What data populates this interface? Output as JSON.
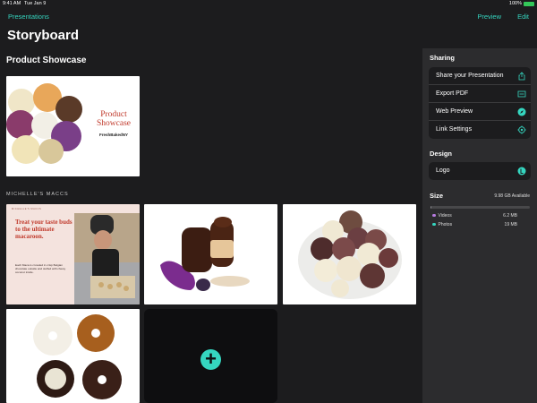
{
  "status": {
    "time": "9:41 AM",
    "date": "Tue Jan 9",
    "battery": "100%"
  },
  "nav": {
    "back": "Presentations",
    "preview": "Preview",
    "edit": "Edit"
  },
  "page": {
    "title": "Storyboard",
    "section": "Product Showcase",
    "subsection": "MICHELLE'S MACCS"
  },
  "tiles": {
    "showcase": {
      "title": "Product Showcase",
      "subtitle": "FreshBakedNY"
    },
    "flyer": {
      "header": "MICHELLE'S MACCS",
      "headline": "Treat your taste buds to the ultimate macaroon.",
      "body": "Each Maca is crowded in crisp Belgian chocolate outside and stuffed with chewy coconut inside."
    },
    "add_icon": "plus-icon"
  },
  "sidebar": {
    "sharing_heading": "Sharing",
    "sharing": [
      {
        "label": "Share your Presentation",
        "icon": "share-icon"
      },
      {
        "label": "Export PDF",
        "icon": "pdf-icon"
      },
      {
        "label": "Web Preview",
        "icon": "compass-icon"
      },
      {
        "label": "Link Settings",
        "icon": "gear-icon"
      }
    ],
    "design_heading": "Design",
    "design": [
      {
        "label": "Logo",
        "icon": "logo-icon"
      }
    ],
    "size_heading": "Size",
    "available": "9.98 GB Available",
    "used_fraction": 0.003,
    "legend": [
      {
        "label": "Videos",
        "value": "6.2 MB",
        "color": "#b77be0"
      },
      {
        "label": "Photos",
        "value": "19 MB",
        "color": "#35d6c0"
      }
    ]
  },
  "colors": {
    "accent": "#35d6c0"
  }
}
